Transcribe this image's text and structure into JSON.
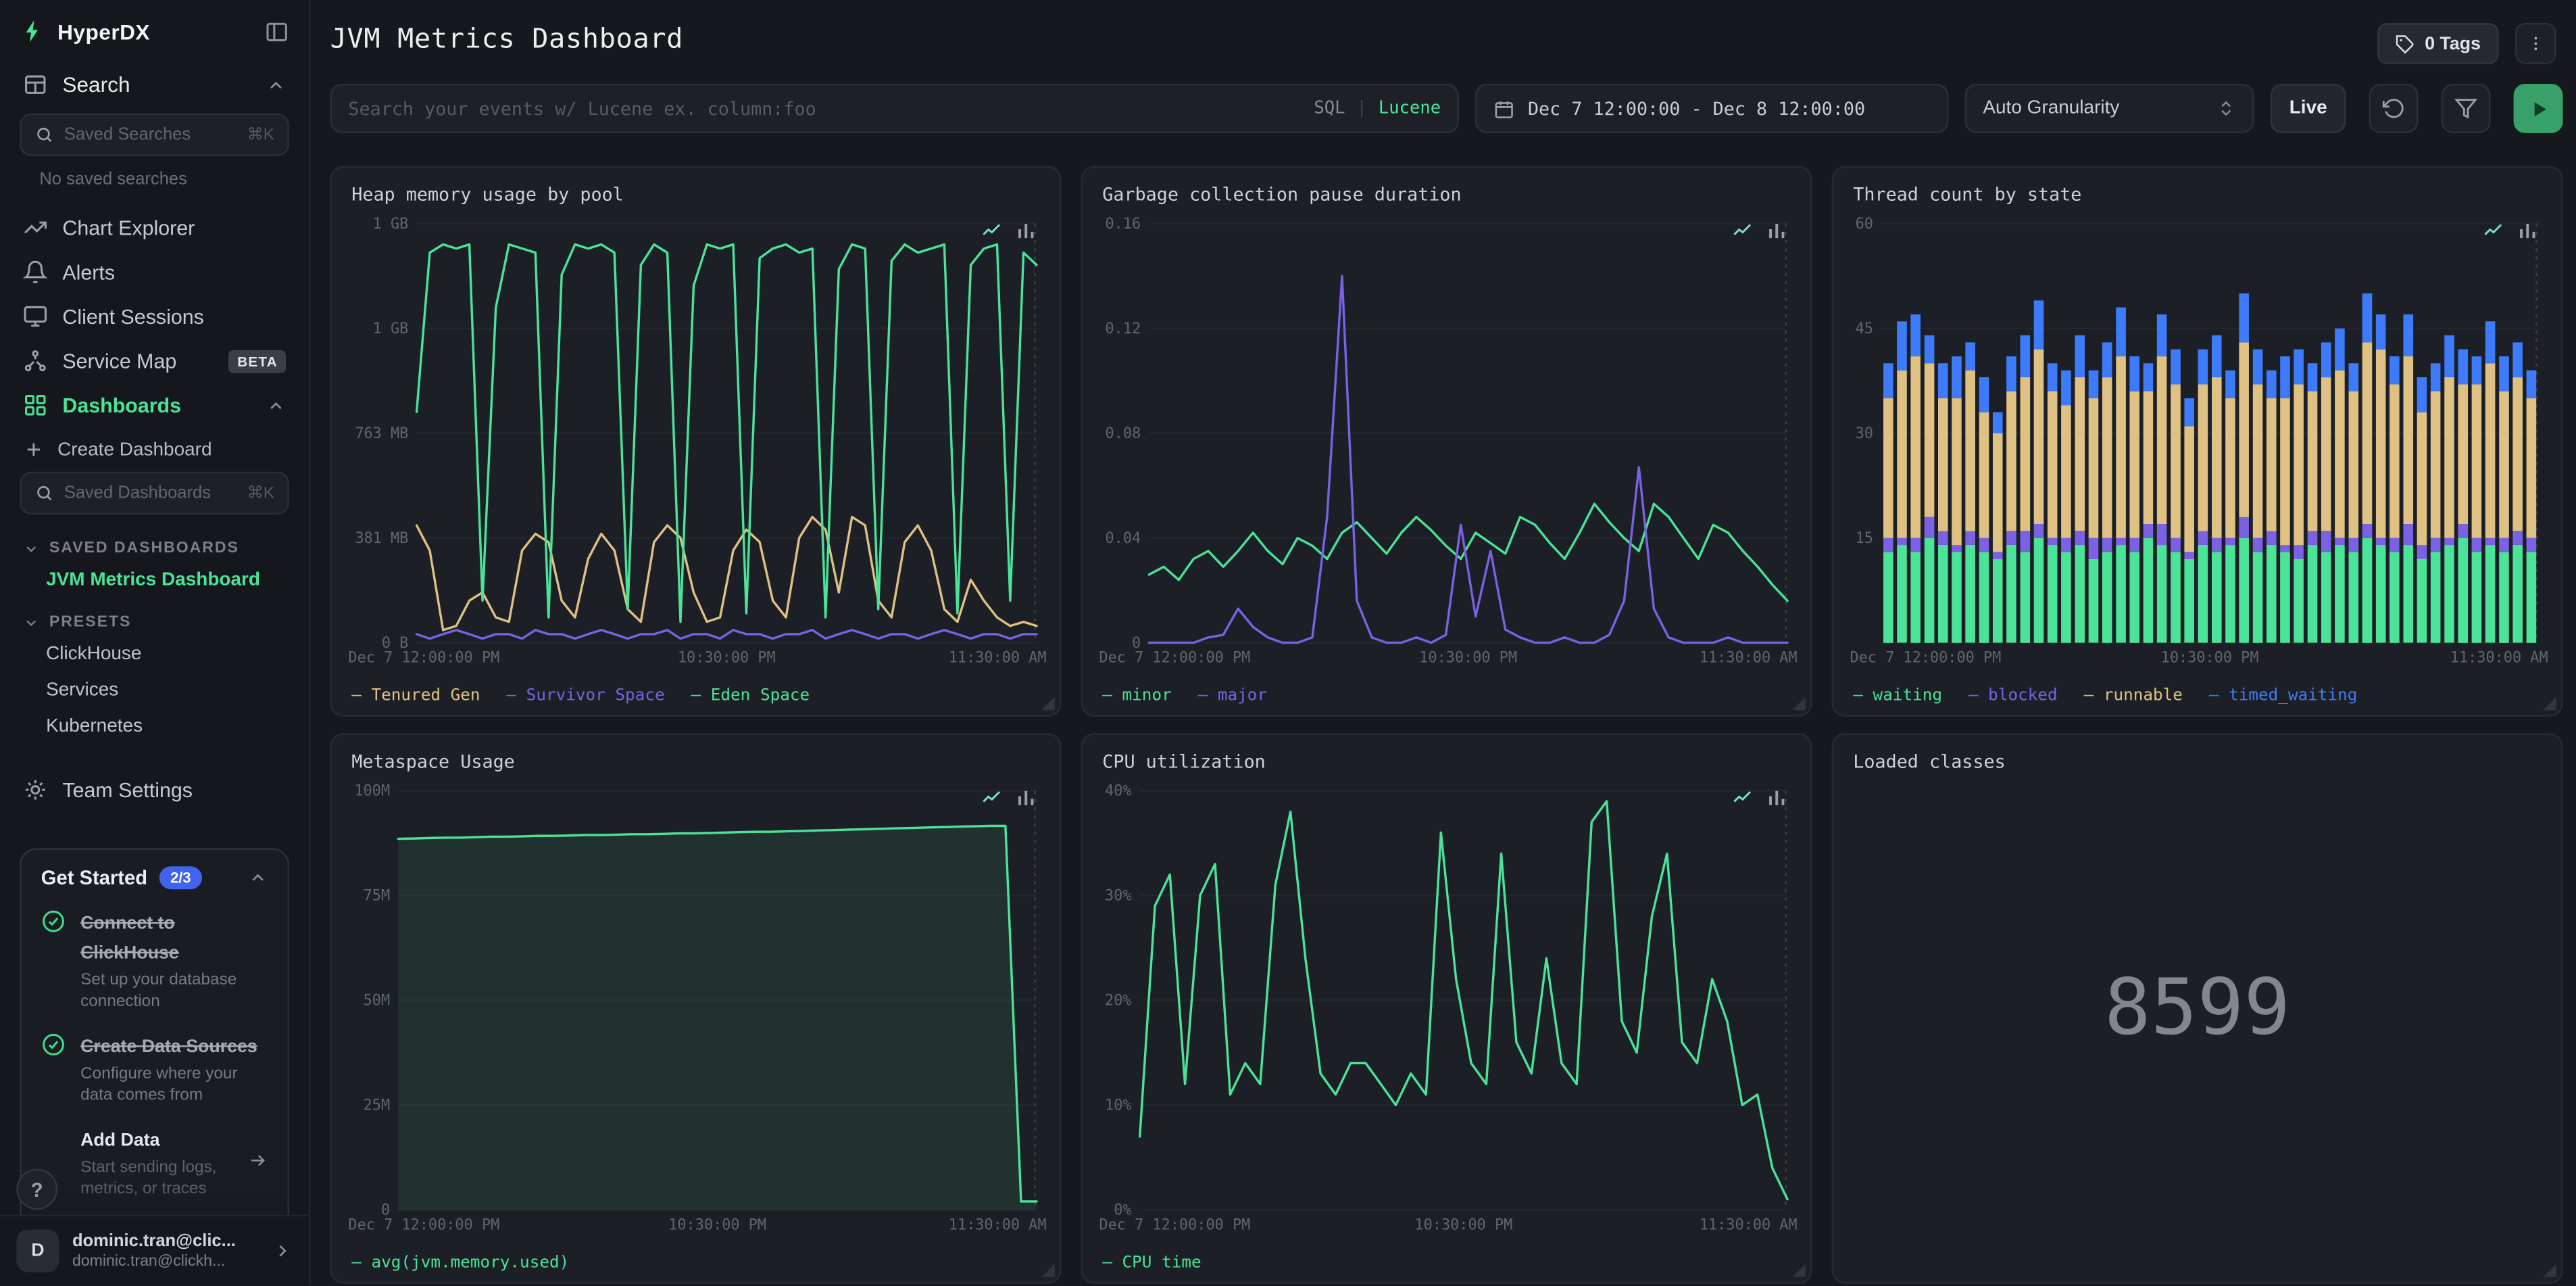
{
  "sidebar": {
    "brand": "HyperDX",
    "search_label": "Search",
    "saved_searches": {
      "placeholder": "Saved Searches",
      "shortcut": "⌘K"
    },
    "no_saved_searches": "No saved searches",
    "nav": [
      {
        "label": "Chart Explorer"
      },
      {
        "label": "Alerts"
      },
      {
        "label": "Client Sessions"
      },
      {
        "label": "Service Map",
        "badge": "BETA"
      },
      {
        "label": "Dashboards"
      }
    ],
    "create_dashboard": "Create Dashboard",
    "saved_dashboards_input": {
      "placeholder": "Saved Dashboards",
      "shortcut": "⌘K"
    },
    "saved_dashboards_header": "SAVED DASHBOARDS",
    "active_dashboard": "JVM Metrics Dashboard",
    "presets_header": "PRESETS",
    "presets": [
      "ClickHouse",
      "Services",
      "Kubernetes"
    ],
    "team_settings": "Team Settings",
    "get_started": {
      "title": "Get Started",
      "progress": "2/3",
      "steps": [
        {
          "title": "Connect to ClickHouse",
          "desc": "Set up your database connection",
          "done": true
        },
        {
          "title": "Create Data Sources",
          "desc": "Configure where your data comes from",
          "done": true
        },
        {
          "title": "Add Data",
          "desc": "Start sending logs, metrics, or traces",
          "done": false
        }
      ]
    },
    "help_label": "?",
    "user": {
      "initial": "D",
      "name": "dominic.tran@clic...",
      "email": "dominic.tran@clickh..."
    }
  },
  "header": {
    "title": "JVM Metrics Dashboard",
    "tags_label": "0 Tags"
  },
  "toolbar": {
    "search_placeholder": "Search your events w/ Lucene ex. column:foo",
    "sql_label": "SQL",
    "divider": "|",
    "lucene_label": "Lucene",
    "date_range": "Dec 7 12:00:00 - Dec 8 12:00:00",
    "granularity": "Auto Granularity",
    "live_label": "Live"
  },
  "charts": [
    {
      "title": "Heap memory usage by pool",
      "chart_data": {
        "type": "line",
        "ymax": 1526,
        "unit": "MB",
        "y_ticks": [
          "1 GB",
          "1 GB",
          "763 MB",
          "381 MB",
          "0 B"
        ],
        "x_ticks": [
          "Dec 7 12:00:00 PM",
          "10:30:00 PM",
          "11:30:00 AM"
        ],
        "series": [
          {
            "name": "Tenured Gen",
            "color": "#dfc183",
            "values": [
              427,
              336,
              46,
              61,
              153,
              183,
              92,
              76,
              336,
              397,
              366,
              153,
              92,
              305,
              397,
              336,
              122,
              76,
              366,
              427,
              382,
              183,
              76,
              92,
              336,
              412,
              366,
              153,
              92,
              382,
              458,
              412,
              183,
              458,
              427,
              153,
              92,
              366,
              427,
              336,
              122,
              76,
              229,
              153,
              92,
              61,
              76,
              61
            ]
          },
          {
            "name": "Survivor Space",
            "color": "#7b61e4",
            "values": [
              31,
              15,
              31,
              46,
              31,
              15,
              31,
              31,
              15,
              46,
              31,
              31,
              15,
              31,
              46,
              31,
              15,
              31,
              31,
              46,
              15,
              31,
              31,
              15,
              46,
              31,
              31,
              15,
              31,
              31,
              46,
              15,
              31,
              46,
              31,
              15,
              31,
              31,
              15,
              31,
              46,
              31,
              15,
              31,
              31,
              15,
              31,
              31
            ]
          },
          {
            "name": "Eden Space",
            "color": "#4be397",
            "values": [
              840,
              1420,
              1450,
              1435,
              1450,
              153,
              1220,
              1450,
              1435,
              1420,
              92,
              1340,
              1450,
              1435,
              1450,
              1420,
              122,
              1375,
              1450,
              1420,
              76,
              1300,
              1450,
              1435,
              1450,
              107,
              1400,
              1435,
              1450,
              1420,
              1435,
              92,
              1360,
              1450,
              1435,
              122,
              1390,
              1450,
              1420,
              1435,
              1450,
              107,
              1375,
              1435,
              1450,
              153,
              1420,
              1375
            ]
          }
        ]
      }
    },
    {
      "title": "Garbage collection pause duration",
      "chart_data": {
        "type": "line",
        "ymax": 0.16,
        "y_ticks": [
          "0.16",
          "0.12",
          "0.08",
          "0.04",
          "0"
        ],
        "x_ticks": [
          "Dec 7 12:00:00 PM",
          "10:30:00 PM",
          "11:30:00 AM"
        ],
        "series": [
          {
            "name": "minor",
            "color": "#4be397",
            "values": [
              0.026,
              0.029,
              0.024,
              0.032,
              0.035,
              0.029,
              0.035,
              0.042,
              0.035,
              0.03,
              0.04,
              0.037,
              0.032,
              0.042,
              0.046,
              0.04,
              0.034,
              0.042,
              0.048,
              0.043,
              0.037,
              0.032,
              0.042,
              0.038,
              0.034,
              0.048,
              0.045,
              0.038,
              0.032,
              0.042,
              0.053,
              0.046,
              0.04,
              0.035,
              0.053,
              0.048,
              0.04,
              0.032,
              0.045,
              0.042,
              0.035,
              0.029,
              0.022,
              0.016
            ]
          },
          {
            "name": "major",
            "color": "#7b61e4",
            "values": [
              0,
              0,
              0,
              0,
              0.002,
              0.003,
              0.013,
              0.006,
              0.002,
              0,
              0,
              0.002,
              0.048,
              0.14,
              0.016,
              0.002,
              0,
              0,
              0.002,
              0,
              0.003,
              0.045,
              0.01,
              0.035,
              0.005,
              0.002,
              0,
              0,
              0.002,
              0,
              0,
              0.003,
              0.016,
              0.067,
              0.013,
              0.002,
              0,
              0,
              0,
              0.002,
              0,
              0,
              0,
              0
            ]
          }
        ]
      }
    },
    {
      "title": "Thread count by state",
      "chart_data": {
        "type": "stacked_bar",
        "ymax": 60,
        "y_ticks": [
          "60",
          "45",
          "30",
          "15",
          ""
        ],
        "x_ticks": [
          "Dec 7 12:00:00 PM",
          "10:30:00 PM",
          "11:30:00 AM"
        ],
        "series": [
          {
            "name": "waiting",
            "color": "#4be397",
            "values": [
              13,
              14,
              13,
              15,
              14,
              13,
              14,
              13,
              12,
              14,
              13,
              15,
              14,
              13,
              14,
              12,
              13,
              14,
              13,
              15,
              14,
              13,
              12,
              14,
              13,
              14,
              15,
              13,
              14,
              13,
              12,
              14,
              13,
              14,
              13,
              15,
              14,
              13,
              14,
              12,
              13,
              14,
              15,
              13,
              14,
              13,
              14,
              13
            ]
          },
          {
            "name": "blocked",
            "color": "#7b61e4",
            "values": [
              2,
              1,
              2,
              3,
              2,
              1,
              2,
              2,
              1,
              2,
              3,
              2,
              1,
              2,
              2,
              3,
              2,
              1,
              2,
              2,
              3,
              2,
              1,
              2,
              2,
              1,
              3,
              2,
              2,
              1,
              2,
              2,
              3,
              1,
              2,
              2,
              1,
              2,
              3,
              2,
              2,
              1,
              2,
              2,
              1,
              2,
              2,
              2
            ]
          },
          {
            "name": "runnable",
            "color": "#dfc183",
            "values": [
              20,
              24,
              26,
              22,
              19,
              21,
              23,
              18,
              17,
              20,
              22,
              25,
              21,
              19,
              22,
              20,
              23,
              26,
              21,
              19,
              24,
              22,
              18,
              21,
              23,
              20,
              25,
              22,
              19,
              21,
              23,
              20,
              22,
              24,
              21,
              26,
              27,
              22,
              24,
              19,
              21,
              23,
              20,
              22,
              25,
              21,
              22,
              20
            ]
          },
          {
            "name": "timed_waiting",
            "color": "#3e7bfa",
            "values": [
              5,
              7,
              6,
              4,
              5,
              6,
              4,
              5,
              3,
              5,
              6,
              7,
              4,
              5,
              6,
              4,
              5,
              7,
              5,
              4,
              6,
              5,
              4,
              5,
              6,
              4,
              7,
              5,
              4,
              6,
              5,
              4,
              5,
              6,
              4,
              7,
              5,
              4,
              6,
              5,
              4,
              6,
              5,
              4,
              6,
              5,
              5,
              4
            ]
          }
        ]
      }
    },
    {
      "title": "Metaspace Usage",
      "chart_data": {
        "type": "line",
        "ymax": 100,
        "unit": "M",
        "y_ticks": [
          "100M",
          "75M",
          "50M",
          "25M",
          "0"
        ],
        "x_ticks": [
          "Dec 7 12:00:00 PM",
          "10:30:00 PM",
          "11:30:00 AM"
        ],
        "series": [
          {
            "name": "avg(jvm.memory.used)",
            "color": "#4be397",
            "fill": true,
            "values": [
              88.5,
              88.6,
              88.7,
              88.8,
              88.8,
              88.9,
              89.0,
              89.0,
              89.1,
              89.2,
              89.2,
              89.3,
              89.4,
              89.4,
              89.5,
              89.6,
              89.6,
              89.7,
              89.8,
              89.8,
              89.9,
              90.0,
              90.1,
              90.2,
              90.2,
              90.3,
              90.4,
              90.5,
              90.6,
              90.7,
              90.8,
              90.9,
              91.0,
              91.1,
              91.2,
              91.3,
              91.4,
              91.5,
              91.6,
              91.6,
              2,
              2
            ]
          }
        ]
      }
    },
    {
      "title": "CPU utilization",
      "chart_data": {
        "type": "line",
        "ymax": 40,
        "unit": "%",
        "y_ticks": [
          "40%",
          "30%",
          "20%",
          "10%",
          "0%"
        ],
        "x_ticks": [
          "Dec 7 12:00:00 PM",
          "10:30:00 PM",
          "11:30:00 AM"
        ],
        "series": [
          {
            "name": "CPU time",
            "color": "#4be397",
            "values": [
              7,
              29,
              32,
              12,
              30,
              33,
              11,
              14,
              12,
              31,
              38,
              24,
              13,
              11,
              14,
              14,
              12,
              10,
              13,
              11,
              36,
              22,
              14,
              12,
              34,
              16,
              13,
              24,
              14,
              12,
              37,
              39,
              18,
              15,
              28,
              34,
              16,
              14,
              22,
              18,
              10,
              11,
              4,
              1
            ]
          }
        ]
      }
    },
    {
      "title": "Loaded classes",
      "chart_data": {
        "type": "number",
        "value": "8599"
      }
    }
  ]
}
